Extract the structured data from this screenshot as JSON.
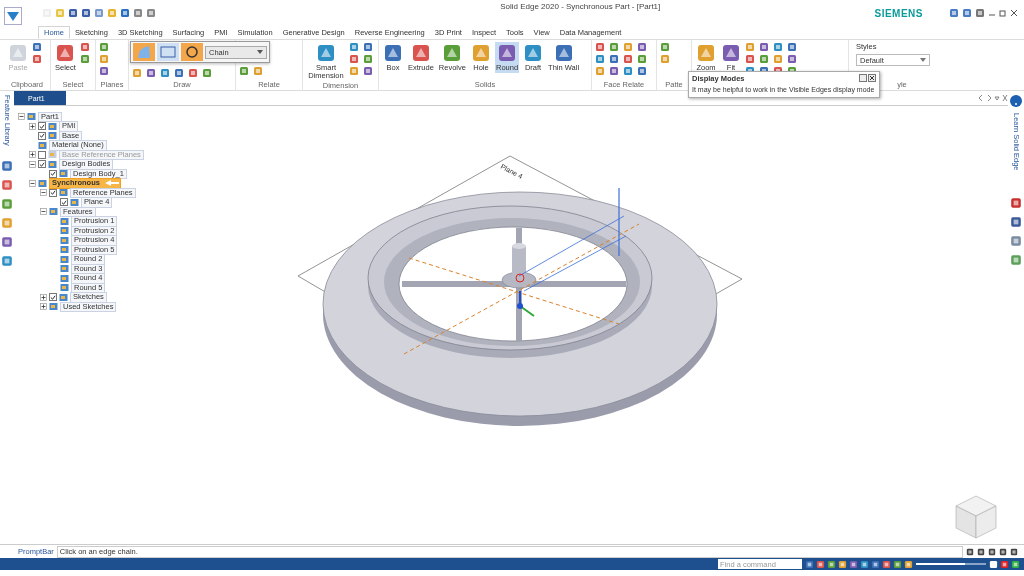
{
  "app": {
    "title": "Solid Edge 2020 - Synchronous Part - [Part1]",
    "brand": "SIEMENS"
  },
  "ribbon_tabs": [
    {
      "label": "Home",
      "selected": true
    },
    {
      "label": "Sketching",
      "selected": false
    },
    {
      "label": "3D Sketching",
      "selected": false
    },
    {
      "label": "Surfacing",
      "selected": false
    },
    {
      "label": "PMI",
      "selected": false
    },
    {
      "label": "Simulation",
      "selected": false
    },
    {
      "label": "Generative Design",
      "selected": false
    },
    {
      "label": "Reverse Engineering",
      "selected": false
    },
    {
      "label": "3D Print",
      "selected": false
    },
    {
      "label": "Inspect",
      "selected": false
    },
    {
      "label": "Tools",
      "selected": false
    },
    {
      "label": "View",
      "selected": false
    },
    {
      "label": "Data Management",
      "selected": false
    }
  ],
  "ribbon_groups": [
    {
      "label": "Clipboard",
      "buttons": [
        {
          "label": "Paste",
          "selected": false,
          "disabled": true
        }
      ]
    },
    {
      "label": "Select",
      "buttons": [
        {
          "label": "Select",
          "selected": false,
          "disabled": false
        }
      ]
    },
    {
      "label": "Planes"
    },
    {
      "label": "Draw"
    },
    {
      "label": "Relate"
    },
    {
      "label": "Dimension",
      "buttons": [
        {
          "label": "Smart Dimension",
          "selected": false,
          "disabled": false
        }
      ]
    },
    {
      "label": "Solids",
      "buttons": [
        {
          "label": "Box",
          "selected": false,
          "disabled": false
        },
        {
          "label": "Extrude",
          "selected": false,
          "disabled": false
        },
        {
          "label": "Revolve",
          "selected": false,
          "disabled": false
        },
        {
          "label": "Hole",
          "selected": false,
          "disabled": false
        },
        {
          "label": "Round",
          "selected": true,
          "disabled": false
        },
        {
          "label": "Draft",
          "selected": false,
          "disabled": false
        },
        {
          "label": "Thin Wall",
          "selected": false,
          "disabled": false
        }
      ]
    },
    {
      "label": "Face Relate"
    },
    {
      "label": "Patte"
    },
    {
      "buttons": [
        {
          "label": "Zoom",
          "selected": false,
          "disabled": false
        },
        {
          "label": "Fit",
          "selected": false,
          "disabled": false
        }
      ]
    },
    {
      "label": "yle",
      "styles": {
        "label": "Styles",
        "value": "Default"
      }
    }
  ],
  "command_bar": {
    "dropdown": "Chain"
  },
  "tooltip": {
    "title": "Display Modes",
    "text": "It may be helpful to work in the Visible Edges display mode"
  },
  "left_bar": {
    "title": "Feature Library"
  },
  "right_bar": {
    "title": "Learn Solid Edge"
  },
  "document_tabs": [
    {
      "label": "Part1",
      "selected": true
    }
  ],
  "tree": [
    {
      "label": "Part1",
      "selected": false,
      "disabled": false,
      "expanded": true,
      "children": [
        {
          "label": "PMI",
          "checked": true,
          "expanded": false,
          "selected": false,
          "disabled": false
        },
        {
          "label": "Base",
          "checked": true,
          "selected": false,
          "disabled": false
        },
        {
          "label": "Material (None)",
          "selected": false,
          "disabled": false
        },
        {
          "label": "Base Reference Planes",
          "checked": false,
          "expanded": false,
          "selected": false,
          "disabled": true
        },
        {
          "label": "Design Bodies",
          "checked": true,
          "expanded": true,
          "selected": false,
          "disabled": false,
          "children": [
            {
              "label": "Design Body_1",
              "checked": true,
              "selected": false,
              "disabled": false
            }
          ]
        },
        {
          "label": "Synchronous",
          "expanded": true,
          "selected": true,
          "disabled": false,
          "children": [
            {
              "label": "Reference Planes",
              "checked": true,
              "expanded": true,
              "selected": false,
              "disabled": false,
              "children": [
                {
                  "label": "Plane 4",
                  "checked": true,
                  "selected": false,
                  "disabled": false
                }
              ]
            },
            {
              "label": "Features",
              "expanded": true,
              "selected": false,
              "disabled": false,
              "children": [
                {
                  "label": "Protrusion 1",
                  "selected": false,
                  "disabled": false
                },
                {
                  "label": "Protrusion 2",
                  "selected": false,
                  "disabled": false
                },
                {
                  "label": "Protrusion 4",
                  "selected": false,
                  "disabled": false
                },
                {
                  "label": "Protrusion 5",
                  "selected": false,
                  "disabled": false
                },
                {
                  "label": "Round 2",
                  "selected": false,
                  "disabled": false
                },
                {
                  "label": "Round 3",
                  "selected": false,
                  "disabled": false
                },
                {
                  "label": "Round 4",
                  "selected": false,
                  "disabled": false
                },
                {
                  "label": "Round 5",
                  "selected": false,
                  "disabled": false
                }
              ]
            },
            {
              "label": "Sketches",
              "checked": true,
              "expanded": false,
              "selected": false,
              "disabled": false
            },
            {
              "label": "Used Sketches",
              "expanded": false,
              "selected": false,
              "disabled": false
            }
          ]
        }
      ]
    }
  ],
  "viewport": {
    "plane_label": "Plane 4"
  },
  "prompt_bar": {
    "label": "PromptBar",
    "text": "Click on an edge chain."
  },
  "status_bar": {
    "search_placeholder": "Find a command",
    "zoom_slider": {
      "level": 0.7
    }
  }
}
